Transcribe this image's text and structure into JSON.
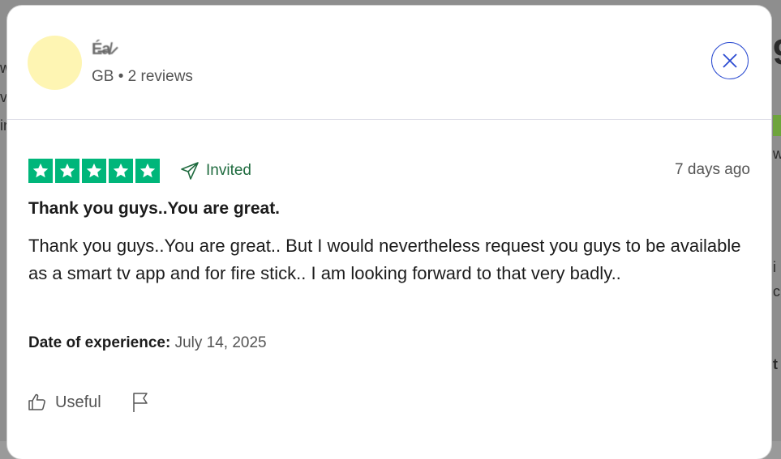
{
  "reviewer": {
    "name": "É̶a̸ ̷",
    "country": "GB",
    "separator": "•",
    "review_count": "2 reviews",
    "meta": "GB • 2 reviews"
  },
  "review": {
    "rating": 5,
    "invited_label": "Invited",
    "date_ago": "7 days ago",
    "title": "Thank you guys..You are great.",
    "body": "Thank you guys..You are great.. But I would nevertheless request you guys to be available as a smart tv app and for fire stick.. I am looking forward to that very badly..",
    "experience_label": "Date of experience:",
    "experience_date": "July 14, 2025"
  },
  "actions": {
    "useful_label": "Useful"
  },
  "colors": {
    "star_green": "#00b67a",
    "invited_green": "#1f6b3f",
    "close_blue": "#2b4bd1"
  },
  "icons": {
    "close": "close-icon",
    "star": "star-icon",
    "invited": "send-icon",
    "useful": "thumbs-up-icon",
    "flag": "flag-icon"
  }
}
